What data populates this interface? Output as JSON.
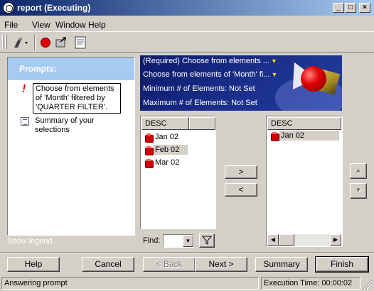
{
  "window": {
    "title": "report (Executing)",
    "minimize": "_",
    "maximize": "□",
    "close": "×"
  },
  "menu": {
    "file": "File",
    "view": "View",
    "window": "Window",
    "help": "Help"
  },
  "toolbar": {
    "icons": [
      "run-icon",
      "stop-icon",
      "export-icon",
      "notes-icon"
    ]
  },
  "prompts_panel": {
    "header": "Prompts:",
    "item1": "Choose from elements of 'Month' filtered by 'QUARTER FILTER'.",
    "item2": "Summary of your selections",
    "show_legend": "Show legend"
  },
  "banner": {
    "line1": "(Required) Choose from elements ...",
    "line2": "Choose from elements of 'Month' fi...",
    "line3": "Minimum # of Elements: Not Set",
    "line4": "Maximum # of Elements: Not Set",
    "arrow": "▼"
  },
  "available_list": {
    "header": "DESC",
    "items": [
      "Jan 02",
      "Feb 02",
      "Mar 02"
    ],
    "selected_index": 1
  },
  "selected_list": {
    "header": "DESC",
    "items": [
      "Jan 02"
    ]
  },
  "move_buttons": {
    "add": ">",
    "remove": "<"
  },
  "order_buttons": {
    "up": "▲",
    "down": "▼"
  },
  "find": {
    "label": "Find:",
    "value": "",
    "dropdown": "▼"
  },
  "buttons": {
    "help": "Help",
    "cancel": "Cancel",
    "back": "< Back",
    "next": "Next >",
    "summary": "Summary",
    "finish": "Finish"
  },
  "status": {
    "message": "Answering prompt",
    "execution_time": "Execution Time: 00:00:02"
  },
  "colors": {
    "titlebar_start": "#0a246a",
    "titlebar_end": "#a6caf0",
    "prompts_header": "#a6caf0",
    "banner_bg": "#0c1a6a",
    "accent_red": "#d00000"
  }
}
